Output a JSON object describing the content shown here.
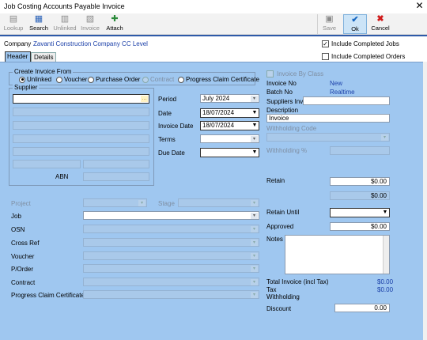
{
  "window": {
    "title": "Job Costing Accounts Payable Invoice",
    "close": "✕"
  },
  "toolbar": {
    "lookup": "Lookup",
    "search": "Search",
    "unlinked": "Unlinked",
    "invoice": "Invoice",
    "attach": "Attach",
    "save": "Save",
    "ok": "Ok",
    "cancel": "Cancel"
  },
  "company": {
    "label": "Company",
    "value": "Zavanti Construction Company CC Level"
  },
  "checks": {
    "include_completed_jobs": "Include Completed Jobs",
    "include_completed_orders": "Include Completed Orders"
  },
  "tabs": {
    "header": "Header",
    "details": "Details"
  },
  "create_from": {
    "title": "Create Invoice From",
    "options": [
      "Unlinked",
      "Voucher",
      "Purchase Order",
      "Contract",
      "Progress Claim Certificate"
    ]
  },
  "supplier": {
    "title": "Supplier",
    "abn": "ABN"
  },
  "fields": {
    "period": "Period",
    "period_value": "July 2024",
    "date": "Date",
    "date_value": "18/07/2024",
    "invoice_date": "Invoice Date",
    "invoice_date_value": "18/07/2024",
    "terms": "Terms",
    "due_date": "Due Date"
  },
  "right": {
    "invoice_by_class": "Invoice By Class",
    "invoice_no": "Invoice No",
    "invoice_no_value": "New",
    "batch_no": "Batch No",
    "batch_no_value": "Realtime",
    "suppliers_inv": "Suppliers Inv.",
    "description": "Description",
    "description_value": "Invoice",
    "withholding_code": "Withholding Code",
    "withholding_pct": "Withholding %"
  },
  "lower": {
    "project": "Project",
    "stage": "Stage",
    "job": "Job",
    "osn": "OSN",
    "cross_ref": "Cross Ref",
    "voucher": "Voucher",
    "porder": "P/Order",
    "contract": "Contract",
    "progress_claim": "Progress Claim Certificate"
  },
  "totals": {
    "retain": "Retain",
    "retain_value": "$0.00",
    "retain_value2": "$0.00",
    "retain_until": "Retain Until",
    "approved": "Approved",
    "approved_value": "$0.00",
    "notes": "Notes",
    "total_invoice": "Total Invoice (incl Tax)",
    "total_invoice_value": "$0.00",
    "tax": "Tax",
    "tax_value": "$0.00",
    "withholding": "Withholding",
    "discount": "Discount",
    "discount_value": "0.00"
  }
}
